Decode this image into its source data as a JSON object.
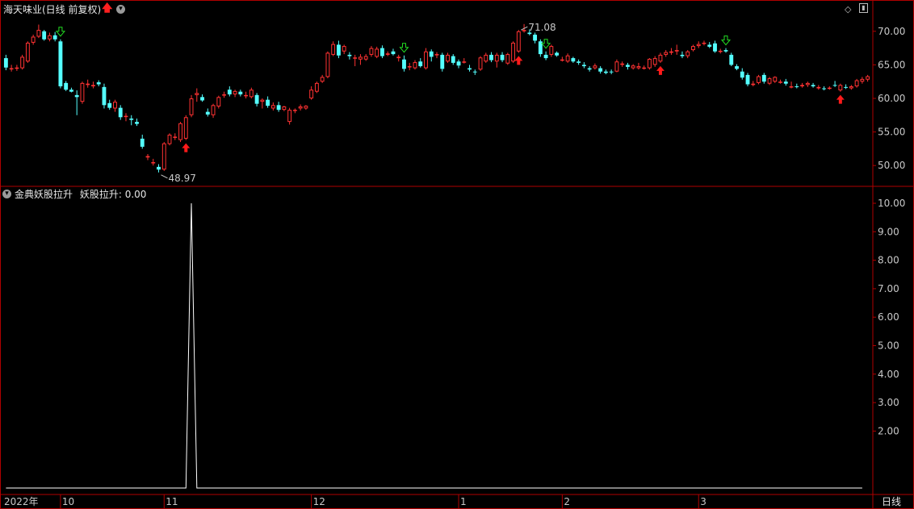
{
  "header": {
    "title": "海天味业(日线 前复权)",
    "indicator_title": "金典妖股拉升",
    "indicator_value_text": "妖股拉升: 0.00",
    "timeframe": "日线"
  },
  "colors": {
    "background": "#000000",
    "border": "#b00000",
    "up": "#ff3232",
    "down": "#54ffff",
    "axis_text": "#c8c8c8",
    "line": "#ffffff",
    "buy_arrow": "#ff1a1a",
    "sell_arrow": "#22dd22"
  },
  "icons": {
    "title_arrow": "red-up-arrow-icon",
    "dropdown": "chevron-down-icon"
  },
  "chart_data": [
    {
      "type": "candlestick",
      "title": "海天味业(日线 前复权)",
      "ylim": [
        47.5,
        72.5
      ],
      "yticks": [
        50.0,
        55.0,
        60.0,
        65.0,
        70.0
      ],
      "annotations": [
        {
          "label": "48.97",
          "index": 28,
          "kind": "low"
        },
        {
          "label": "71.08",
          "index": 94,
          "kind": "high"
        }
      ],
      "buy_signals": [
        33,
        94,
        120,
        153
      ],
      "sell_signals": [
        10,
        73,
        99,
        132
      ],
      "x_labels": [
        {
          "label": "2022年",
          "index": 0
        },
        {
          "label": "10",
          "index": 10
        },
        {
          "label": "11",
          "index": 29
        },
        {
          "label": "12",
          "index": 56
        },
        {
          "label": "1",
          "index": 83
        },
        {
          "label": "2",
          "index": 102
        },
        {
          "label": "3",
          "index": 127
        }
      ],
      "ohlc": [
        [
          66.0,
          66.5,
          64.2,
          64.6
        ],
        [
          64.5,
          65.0,
          64.0,
          64.5
        ],
        [
          64.6,
          65.0,
          64.1,
          64.6
        ],
        [
          64.5,
          66.5,
          64.3,
          66.2
        ],
        [
          65.5,
          68.5,
          65.3,
          68.3
        ],
        [
          68.3,
          69.5,
          68.0,
          69.2
        ],
        [
          69.2,
          71.0,
          69.0,
          70.2
        ],
        [
          70.0,
          70.2,
          68.6,
          68.8
        ],
        [
          68.8,
          69.8,
          68.5,
          69.4
        ],
        [
          69.4,
          69.9,
          68.5,
          68.8
        ],
        [
          68.5,
          68.8,
          61.5,
          61.8
        ],
        [
          62.3,
          62.6,
          61.1,
          61.3
        ],
        [
          61.3,
          61.6,
          60.9,
          61.0
        ],
        [
          60.5,
          61.2,
          57.5,
          60.2
        ],
        [
          59.5,
          62.5,
          59.2,
          62.3
        ],
        [
          62.0,
          62.8,
          61.6,
          62.2
        ],
        [
          61.8,
          62.5,
          61.5,
          62.0
        ],
        [
          62.4,
          62.7,
          61.8,
          62.1
        ],
        [
          61.7,
          62.2,
          58.5,
          59.0
        ],
        [
          59.3,
          59.8,
          58.3,
          58.6
        ],
        [
          58.5,
          59.8,
          58.0,
          59.5
        ],
        [
          58.6,
          59.0,
          56.8,
          57.2
        ],
        [
          57.3,
          57.8,
          56.6,
          57.4
        ],
        [
          57.0,
          57.5,
          56.0,
          56.8
        ],
        [
          56.5,
          57.0,
          55.9,
          56.2
        ],
        [
          54.0,
          54.6,
          52.5,
          52.8
        ],
        [
          51.2,
          51.7,
          50.8,
          51.4
        ],
        [
          50.5,
          51.0,
          50.0,
          50.5
        ],
        [
          49.8,
          50.2,
          48.97,
          49.4
        ],
        [
          49.4,
          53.5,
          49.2,
          53.3
        ],
        [
          53.2,
          54.8,
          53.0,
          54.6
        ],
        [
          54.2,
          54.8,
          53.8,
          54.3
        ],
        [
          53.8,
          56.5,
          53.5,
          56.3
        ],
        [
          54.0,
          57.5,
          53.8,
          57.2
        ],
        [
          57.5,
          60.5,
          57.2,
          60.0
        ],
        [
          60.5,
          61.5,
          59.5,
          60.8
        ],
        [
          60.2,
          60.6,
          59.5,
          59.7
        ],
        [
          58.0,
          58.5,
          57.3,
          57.6
        ],
        [
          57.5,
          59.2,
          57.1,
          59.0
        ],
        [
          58.8,
          60.4,
          58.5,
          60.2
        ],
        [
          60.5,
          61.0,
          60.1,
          60.6
        ],
        [
          61.3,
          61.8,
          60.3,
          60.6
        ],
        [
          60.6,
          61.3,
          60.2,
          61.1
        ],
        [
          61.0,
          61.3,
          60.3,
          60.6
        ],
        [
          60.5,
          61.0,
          60.0,
          60.5
        ],
        [
          60.2,
          61.6,
          60.0,
          61.3
        ],
        [
          60.5,
          60.8,
          58.8,
          59.2
        ],
        [
          59.5,
          60.0,
          58.5,
          59.8
        ],
        [
          59.8,
          60.3,
          58.6,
          58.9
        ],
        [
          58.5,
          59.4,
          58.2,
          59.0
        ],
        [
          59.0,
          59.5,
          58.0,
          58.3
        ],
        [
          58.3,
          58.9,
          58.1,
          58.8
        ],
        [
          56.5,
          58.6,
          56.1,
          58.3
        ],
        [
          58.2,
          58.5,
          57.8,
          58.3
        ],
        [
          58.5,
          59.1,
          58.2,
          58.8
        ],
        [
          58.5,
          59.0,
          58.3,
          58.9
        ],
        [
          60.0,
          61.8,
          59.8,
          61.3
        ],
        [
          61.0,
          62.5,
          60.8,
          62.3
        ],
        [
          62.5,
          63.5,
          62.3,
          63.2
        ],
        [
          63.2,
          67.0,
          63.0,
          66.8
        ],
        [
          66.5,
          68.5,
          66.3,
          68.1
        ],
        [
          68.0,
          68.6,
          66.0,
          66.4
        ],
        [
          67.0,
          68.0,
          66.6,
          67.8
        ],
        [
          66.5,
          66.9,
          65.8,
          66.3
        ],
        [
          66.0,
          66.5,
          64.8,
          66.1
        ],
        [
          65.8,
          66.6,
          65.0,
          66.2
        ],
        [
          65.8,
          66.6,
          65.6,
          66.3
        ],
        [
          66.5,
          67.8,
          66.2,
          67.5
        ],
        [
          66.2,
          67.7,
          66.0,
          67.4
        ],
        [
          67.5,
          67.9,
          66.0,
          66.3
        ],
        [
          66.5,
          67.0,
          66.3,
          66.7
        ],
        [
          67.0,
          67.4,
          66.4,
          66.6
        ],
        [
          66.0,
          66.5,
          65.5,
          66.2
        ],
        [
          65.8,
          66.4,
          64.0,
          64.4
        ],
        [
          64.8,
          65.3,
          64.2,
          64.8
        ],
        [
          64.5,
          65.7,
          64.3,
          65.4
        ],
        [
          65.5,
          66.0,
          64.6,
          64.8
        ],
        [
          64.5,
          67.5,
          64.3,
          67.0
        ],
        [
          67.0,
          67.3,
          65.5,
          66.2
        ],
        [
          66.5,
          66.9,
          66.0,
          66.6
        ],
        [
          66.5,
          66.8,
          64.0,
          64.4
        ],
        [
          65.5,
          66.8,
          65.3,
          66.5
        ],
        [
          66.3,
          66.6,
          65.0,
          65.3
        ],
        [
          65.5,
          65.8,
          64.5,
          64.9
        ],
        [
          65.5,
          66.0,
          65.2,
          65.5
        ],
        [
          64.5,
          65.0,
          64.0,
          64.3
        ],
        [
          64.0,
          64.3,
          63.5,
          63.9
        ],
        [
          64.3,
          66.3,
          64.1,
          66.1
        ],
        [
          65.5,
          66.8,
          65.3,
          66.5
        ],
        [
          66.5,
          66.9,
          65.4,
          65.7
        ],
        [
          65.5,
          66.8,
          64.6,
          66.5
        ],
        [
          66.5,
          66.9,
          65.4,
          65.7
        ],
        [
          65.2,
          66.8,
          65.0,
          66.6
        ],
        [
          65.5,
          68.5,
          65.3,
          68.3
        ],
        [
          67.0,
          70.2,
          66.8,
          70.0
        ],
        [
          70.0,
          71.08,
          69.8,
          70.2
        ],
        [
          69.8,
          70.3,
          69.4,
          69.6
        ],
        [
          69.5,
          69.8,
          68.2,
          68.6
        ],
        [
          68.5,
          68.8,
          66.2,
          66.6
        ],
        [
          66.5,
          67.0,
          65.7,
          66.0
        ],
        [
          66.5,
          68.0,
          66.2,
          67.8
        ],
        [
          66.8,
          67.0,
          66.2,
          66.4
        ],
        [
          65.8,
          66.2,
          65.5,
          65.8
        ],
        [
          65.5,
          66.7,
          65.3,
          66.4
        ],
        [
          66.0,
          66.2,
          65.3,
          65.5
        ],
        [
          65.5,
          65.8,
          65.0,
          65.3
        ],
        [
          65.0,
          65.4,
          64.5,
          64.8
        ],
        [
          64.5,
          64.8,
          64.0,
          64.3
        ],
        [
          64.5,
          65.2,
          64.3,
          64.9
        ],
        [
          64.5,
          64.8,
          63.7,
          64.0
        ],
        [
          64.0,
          64.3,
          63.6,
          63.8
        ],
        [
          64.0,
          64.3,
          63.6,
          63.9
        ],
        [
          64.0,
          65.8,
          63.9,
          65.5
        ],
        [
          65.0,
          65.5,
          64.7,
          65.2
        ],
        [
          65.0,
          65.3,
          64.3,
          64.7
        ],
        [
          64.5,
          65.1,
          64.3,
          64.9
        ],
        [
          64.5,
          65.3,
          64.3,
          64.8
        ],
        [
          64.5,
          64.9,
          64.3,
          64.6
        ],
        [
          64.5,
          66.0,
          64.3,
          65.9
        ],
        [
          65.0,
          66.3,
          64.7,
          66.0
        ],
        [
          65.5,
          66.8,
          65.3,
          66.5
        ],
        [
          66.5,
          67.2,
          66.2,
          66.9
        ],
        [
          66.8,
          67.5,
          66.5,
          67.0
        ],
        [
          67.0,
          68.0,
          66.5,
          67.2
        ],
        [
          66.5,
          67.0,
          66.0,
          66.3
        ],
        [
          66.3,
          67.2,
          66.0,
          67.0
        ],
        [
          67.2,
          68.0,
          67.0,
          67.8
        ],
        [
          67.8,
          68.5,
          67.5,
          68.1
        ],
        [
          68.2,
          68.6,
          67.9,
          68.3
        ],
        [
          68.0,
          68.4,
          67.5,
          67.7
        ],
        [
          68.2,
          68.6,
          66.8,
          67.0
        ],
        [
          67.0,
          67.4,
          66.7,
          67.1
        ],
        [
          67.2,
          67.5,
          66.8,
          67.0
        ],
        [
          66.5,
          66.8,
          64.8,
          65.0
        ],
        [
          64.8,
          65.1,
          64.2,
          64.4
        ],
        [
          64.0,
          64.5,
          62.8,
          63.1
        ],
        [
          63.5,
          63.8,
          61.8,
          62.1
        ],
        [
          62.0,
          62.6,
          61.8,
          62.2
        ],
        [
          62.3,
          63.5,
          62.1,
          63.3
        ],
        [
          63.5,
          63.8,
          62.2,
          62.5
        ],
        [
          62.2,
          63.2,
          62.0,
          63.0
        ],
        [
          62.5,
          63.3,
          62.3,
          63.2
        ],
        [
          62.5,
          62.8,
          62.2,
          62.5
        ],
        [
          62.5,
          62.9,
          61.9,
          62.2
        ],
        [
          61.8,
          62.5,
          61.5,
          61.8
        ],
        [
          61.8,
          62.2,
          61.5,
          61.7
        ],
        [
          61.8,
          62.3,
          61.6,
          62.0
        ],
        [
          62.0,
          62.5,
          61.7,
          62.3
        ],
        [
          62.0,
          62.3,
          61.6,
          61.8
        ],
        [
          61.5,
          62.0,
          61.3,
          61.7
        ],
        [
          61.5,
          61.8,
          61.2,
          61.4
        ],
        [
          61.5,
          61.8,
          61.3,
          61.6
        ],
        [
          62.0,
          62.6,
          61.7,
          61.9
        ],
        [
          61.2,
          62.2,
          61.0,
          62.0
        ],
        [
          61.7,
          62.1,
          61.4,
          61.6
        ],
        [
          61.5,
          62.0,
          61.3,
          61.8
        ],
        [
          61.8,
          62.9,
          61.6,
          62.7
        ],
        [
          62.5,
          63.2,
          62.2,
          62.9
        ],
        [
          62.8,
          63.5,
          62.5,
          63.3
        ]
      ]
    },
    {
      "type": "line",
      "title": "金典妖股拉升",
      "series_name": "妖股拉升",
      "ylim": [
        0,
        10
      ],
      "yticks": [
        2.0,
        3.0,
        4.0,
        5.0,
        6.0,
        7.0,
        8.0,
        9.0,
        10.0
      ],
      "values": [
        0,
        0,
        0,
        0,
        0,
        0,
        0,
        0,
        0,
        0,
        0,
        0,
        0,
        0,
        0,
        0,
        0,
        0,
        0,
        0,
        0,
        0,
        0,
        0,
        0,
        0,
        0,
        0,
        0,
        0,
        0,
        0,
        0,
        0,
        10,
        0,
        0,
        0,
        0,
        0,
        0,
        0,
        0,
        0,
        0,
        0,
        0,
        0,
        0,
        0,
        0,
        0,
        0,
        0,
        0,
        0,
        0,
        0,
        0,
        0,
        0,
        0,
        0,
        0,
        0,
        0,
        0,
        0,
        0,
        0,
        0,
        0,
        0,
        0,
        0,
        0,
        0,
        0,
        0,
        0,
        0,
        0,
        0,
        0,
        0,
        0,
        0,
        0,
        0,
        0,
        0,
        0,
        0,
        0,
        0,
        0,
        0,
        0,
        0,
        0,
        0,
        0,
        0,
        0,
        0,
        0,
        0,
        0,
        0,
        0,
        0,
        0,
        0,
        0,
        0,
        0,
        0,
        0,
        0,
        0,
        0,
        0,
        0,
        0,
        0,
        0,
        0,
        0,
        0,
        0,
        0,
        0,
        0,
        0,
        0,
        0,
        0,
        0,
        0,
        0,
        0,
        0,
        0,
        0,
        0,
        0,
        0,
        0,
        0,
        0,
        0,
        0,
        0,
        0,
        0,
        0,
        0,
        0
      ]
    }
  ]
}
